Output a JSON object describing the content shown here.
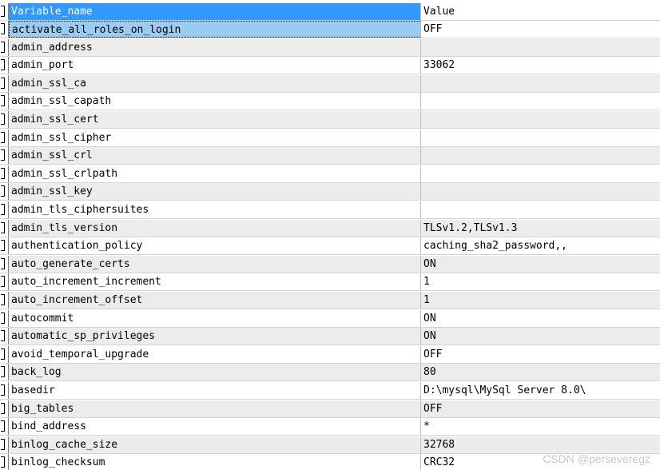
{
  "grid": {
    "columns": [
      "Variable_name",
      "Value"
    ],
    "rows": [
      [
        "activate_all_roles_on_login",
        "OFF"
      ],
      [
        "admin_address",
        ""
      ],
      [
        "admin_port",
        "33062"
      ],
      [
        "admin_ssl_ca",
        ""
      ],
      [
        "admin_ssl_capath",
        ""
      ],
      [
        "admin_ssl_cert",
        ""
      ],
      [
        "admin_ssl_cipher",
        ""
      ],
      [
        "admin_ssl_crl",
        ""
      ],
      [
        "admin_ssl_crlpath",
        ""
      ],
      [
        "admin_ssl_key",
        ""
      ],
      [
        "admin_tls_ciphersuites",
        ""
      ],
      [
        "admin_tls_version",
        "TLSv1.2,TLSv1.3"
      ],
      [
        "authentication_policy",
        "caching_sha2_password,,"
      ],
      [
        "auto_generate_certs",
        "ON"
      ],
      [
        "auto_increment_increment",
        "1"
      ],
      [
        "auto_increment_offset",
        "1"
      ],
      [
        "autocommit",
        "ON"
      ],
      [
        "automatic_sp_privileges",
        "ON"
      ],
      [
        "avoid_temporal_upgrade",
        "OFF"
      ],
      [
        "back_log",
        "80"
      ],
      [
        "basedir",
        "D:\\mysql\\MySql Server 8.0\\"
      ],
      [
        "big_tables",
        "OFF"
      ],
      [
        "bind_address",
        "*"
      ],
      [
        "binlog_cache_size",
        "32768"
      ],
      [
        "binlog_checksum",
        "CRC32"
      ]
    ],
    "selected_row": 0
  },
  "watermark": "CSDN @perseveregz"
}
